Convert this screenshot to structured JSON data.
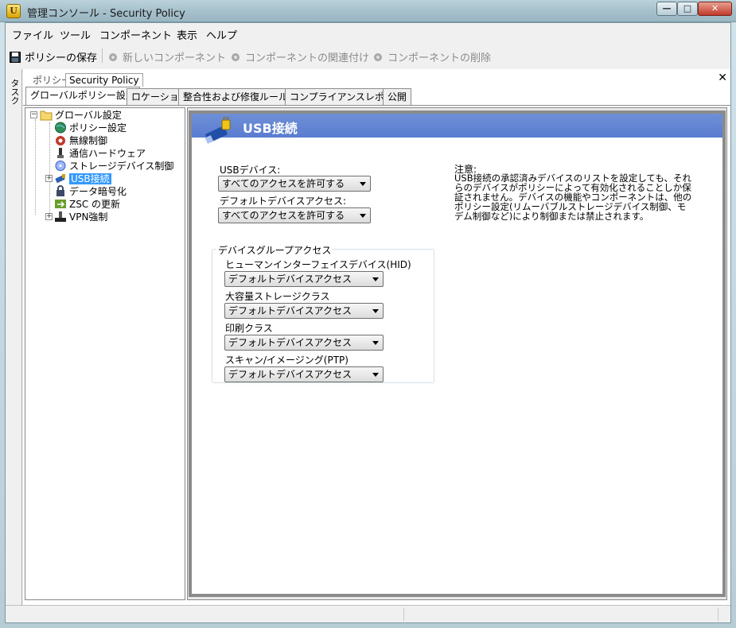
{
  "window": {
    "title": "管理コンソール - Security Policy",
    "app_icon": "shield-app-icon"
  },
  "menu": [
    "ファイル",
    "ツール",
    "コンポーネント",
    "表示",
    "ヘルプ"
  ],
  "toolbar": {
    "save": "ポリシーの保存",
    "new_component": "新しいコンポーネント",
    "associate": "コンポーネントの関連付け",
    "delete": "コンポーネントの削除"
  },
  "task_strip": {
    "label": "タスク"
  },
  "breadcrumb": {
    "section": "ポリシー",
    "name": "Security Policy"
  },
  "tabs": [
    "グローバルポリシー設定",
    "ロケーション",
    "整合性および修復ルール",
    "コンプライアンスレポート",
    "公開"
  ],
  "tree": {
    "root": "グローバル設定",
    "items": [
      "ポリシー設定",
      "無線制御",
      "通信ハードウェア",
      "ストレージデバイス制御",
      "USB接続",
      "データ暗号化",
      "ZSC の更新",
      "VPN強制"
    ],
    "selected": "USB接続"
  },
  "panel": {
    "title": "USB接続",
    "usb_device_label": "USBデバイス:",
    "usb_device_value": "すべてのアクセスを許可する",
    "default_access_label": "デフォルトデバイスアクセス:",
    "default_access_value": "すべてのアクセスを許可する",
    "group_title": "デバイスグループアクセス",
    "groups": [
      {
        "label": "ヒューマンインターフェイスデバイス(HID)",
        "value": "デフォルトデバイスアクセス"
      },
      {
        "label": "大容量ストレージクラス",
        "value": "デフォルトデバイスアクセス"
      },
      {
        "label": "印刷クラス",
        "value": "デフォルトデバイスアクセス"
      },
      {
        "label": "スキャン/イメージング(PTP)",
        "value": "デフォルトデバイスアクセス"
      }
    ],
    "note_title": "注意:",
    "note_text": "USB接続の承認済みデバイスのリストを設定しても、それらのデバイスがポリシーによって有効化されることしか保証されません。デバイスの機能やコンポーネントは、他のポリシー設定(リムーバブルストレージデバイス制御、モデム制御など)により制御または禁止されます。"
  },
  "colors": {
    "header_blue": "#5a7cd0",
    "selection": "#3399ff"
  }
}
